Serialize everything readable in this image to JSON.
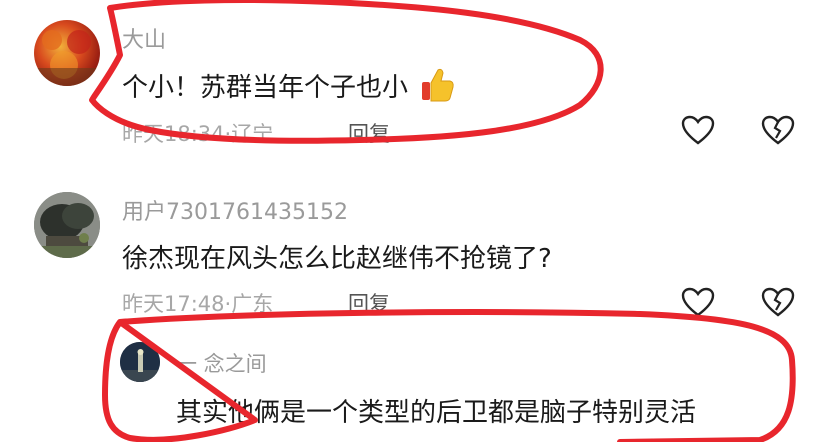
{
  "comments": [
    {
      "avatar": "autumn-leaves-avatar",
      "name": "大山",
      "text": "个小！苏群当年个子也小",
      "emoji": "thumbs-up",
      "time": "昨天18:34",
      "location": "辽宁",
      "reply_label": "回复"
    },
    {
      "avatar": "tree-stone-avatar",
      "name": "用户7301761435152",
      "text": "徐杰现在风头怎么比赵继伟不抢镜了?",
      "time": "昨天17:48",
      "location": "广东",
      "reply_label": "回复"
    }
  ],
  "sub_reply": {
    "avatar": "night-scene-avatar",
    "name": "一 念之间",
    "text": "其实他俩是一个类型的后卫都是脑子特别灵活"
  },
  "icons": [
    "heart-icon",
    "broken-heart-icon"
  ],
  "colors": {
    "annotation": "#e8262d",
    "emoji": "#f5c22b"
  }
}
